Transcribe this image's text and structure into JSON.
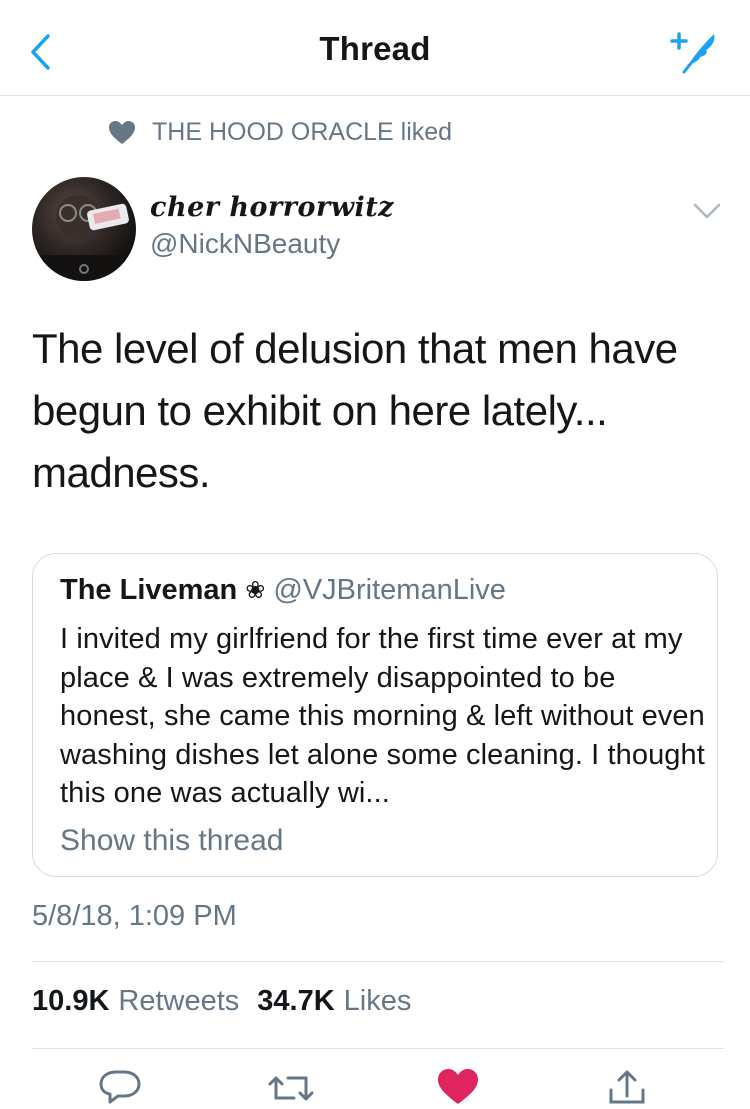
{
  "header": {
    "title": "Thread"
  },
  "social_context": {
    "text": "THE HOOD ORACLE liked"
  },
  "tweet": {
    "display_name": "cher horrorwitz",
    "handle": "@NickNBeauty",
    "text": "The level of delusion that men have\nbegun to exhibit on here lately...\nmadness.",
    "timestamp": "5/8/18, 1:09 PM",
    "retweets_count": "10.9K",
    "retweets_label": "Retweets",
    "likes_count": "34.7K",
    "likes_label": "Likes"
  },
  "quote": {
    "name": "The Liveman",
    "flower": "❀",
    "handle": "@VJBritemanLive",
    "text": "I invited my girlfriend for the first time ever at my place & I was extremely disappointed to be honest, she came this morning & left without even washing dishes let alone some cleaning. I thought this one was actually wi...",
    "show_thread": "Show this thread"
  },
  "colors": {
    "accent": "#1da1f2",
    "like": "#e0245e",
    "secondary_text": "#657786",
    "primary_text": "#14171a"
  },
  "icons": [
    "back-chevron-icon",
    "compose-tweet-icon",
    "heart-icon",
    "avatar",
    "caret-down-icon",
    "reply-icon",
    "retweet-icon",
    "like-icon",
    "share-icon"
  ]
}
